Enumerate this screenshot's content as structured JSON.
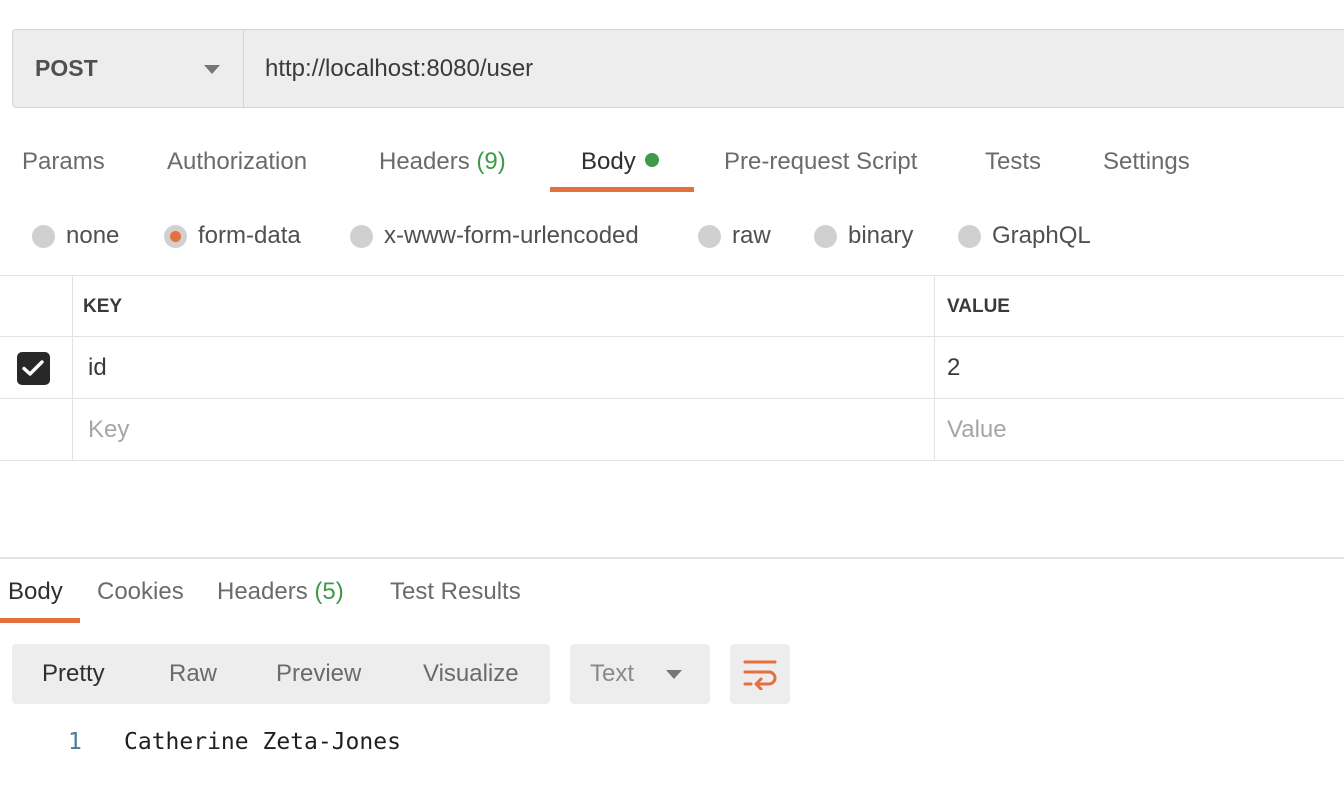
{
  "request": {
    "method": "POST",
    "url": "http://localhost:8080/user"
  },
  "request_tabs": [
    {
      "label": "Params"
    },
    {
      "label": "Authorization"
    },
    {
      "label": "Headers",
      "count": "(9)"
    },
    {
      "label": "Body",
      "active": true,
      "indicator": "green-dot"
    },
    {
      "label": "Pre-request Script"
    },
    {
      "label": "Tests"
    },
    {
      "label": "Settings"
    }
  ],
  "body_types": [
    {
      "label": "none"
    },
    {
      "label": "form-data",
      "selected": true
    },
    {
      "label": "x-www-form-urlencoded"
    },
    {
      "label": "raw"
    },
    {
      "label": "binary"
    },
    {
      "label": "GraphQL"
    }
  ],
  "form_table": {
    "headers": {
      "key": "KEY",
      "value": "VALUE"
    },
    "rows": [
      {
        "checked": true,
        "key": "id",
        "value": "2"
      }
    ],
    "new_row": {
      "key_placeholder": "Key",
      "value_placeholder": "Value"
    }
  },
  "response_tabs": [
    {
      "label": "Body",
      "active": true
    },
    {
      "label": "Cookies"
    },
    {
      "label": "Headers",
      "count": "(5)"
    },
    {
      "label": "Test Results"
    }
  ],
  "response_view": {
    "modes": [
      {
        "label": "Pretty",
        "active": true
      },
      {
        "label": "Raw"
      },
      {
        "label": "Preview"
      },
      {
        "label": "Visualize"
      }
    ],
    "format": "Text",
    "wrap_icon": "wrap-lines-icon"
  },
  "response_body": [
    {
      "line": "1",
      "text": "Catherine Zeta-Jones"
    }
  ],
  "colors": {
    "accent": "#e4703f",
    "count_green": "#3e9a48",
    "control_bg": "#ededed"
  }
}
